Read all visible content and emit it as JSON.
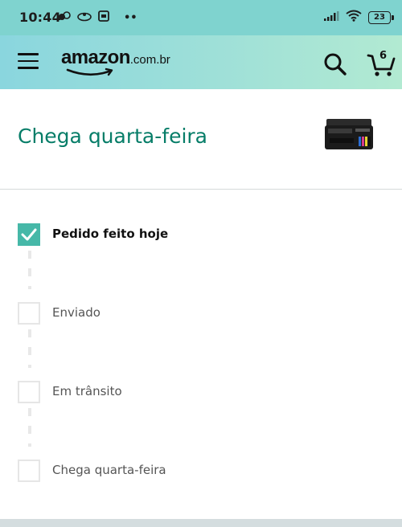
{
  "status_bar": {
    "time": "10:44",
    "left_icons": [
      "notification-icon",
      "cloud-icon",
      "calendar-icon"
    ],
    "more": "••",
    "battery": "23",
    "right_icons": [
      "signal-icon",
      "wifi-icon",
      "battery-icon"
    ]
  },
  "header": {
    "brand": "amazon",
    "brand_suffix": ".com.br",
    "cart_count": "6",
    "background_start": "#8ad6de",
    "background_end": "#b2ead2"
  },
  "delivery": {
    "title": "Chega quarta-feira",
    "title_color": "#067d68"
  },
  "tracking": {
    "steps": [
      {
        "label": "Pedido feito hoje",
        "done": true
      },
      {
        "label": "Enviado",
        "done": false
      },
      {
        "label": "Em trânsito",
        "done": false
      },
      {
        "label": "Chega quarta-feira",
        "done": false
      }
    ],
    "check_color": "#46b8a8"
  }
}
